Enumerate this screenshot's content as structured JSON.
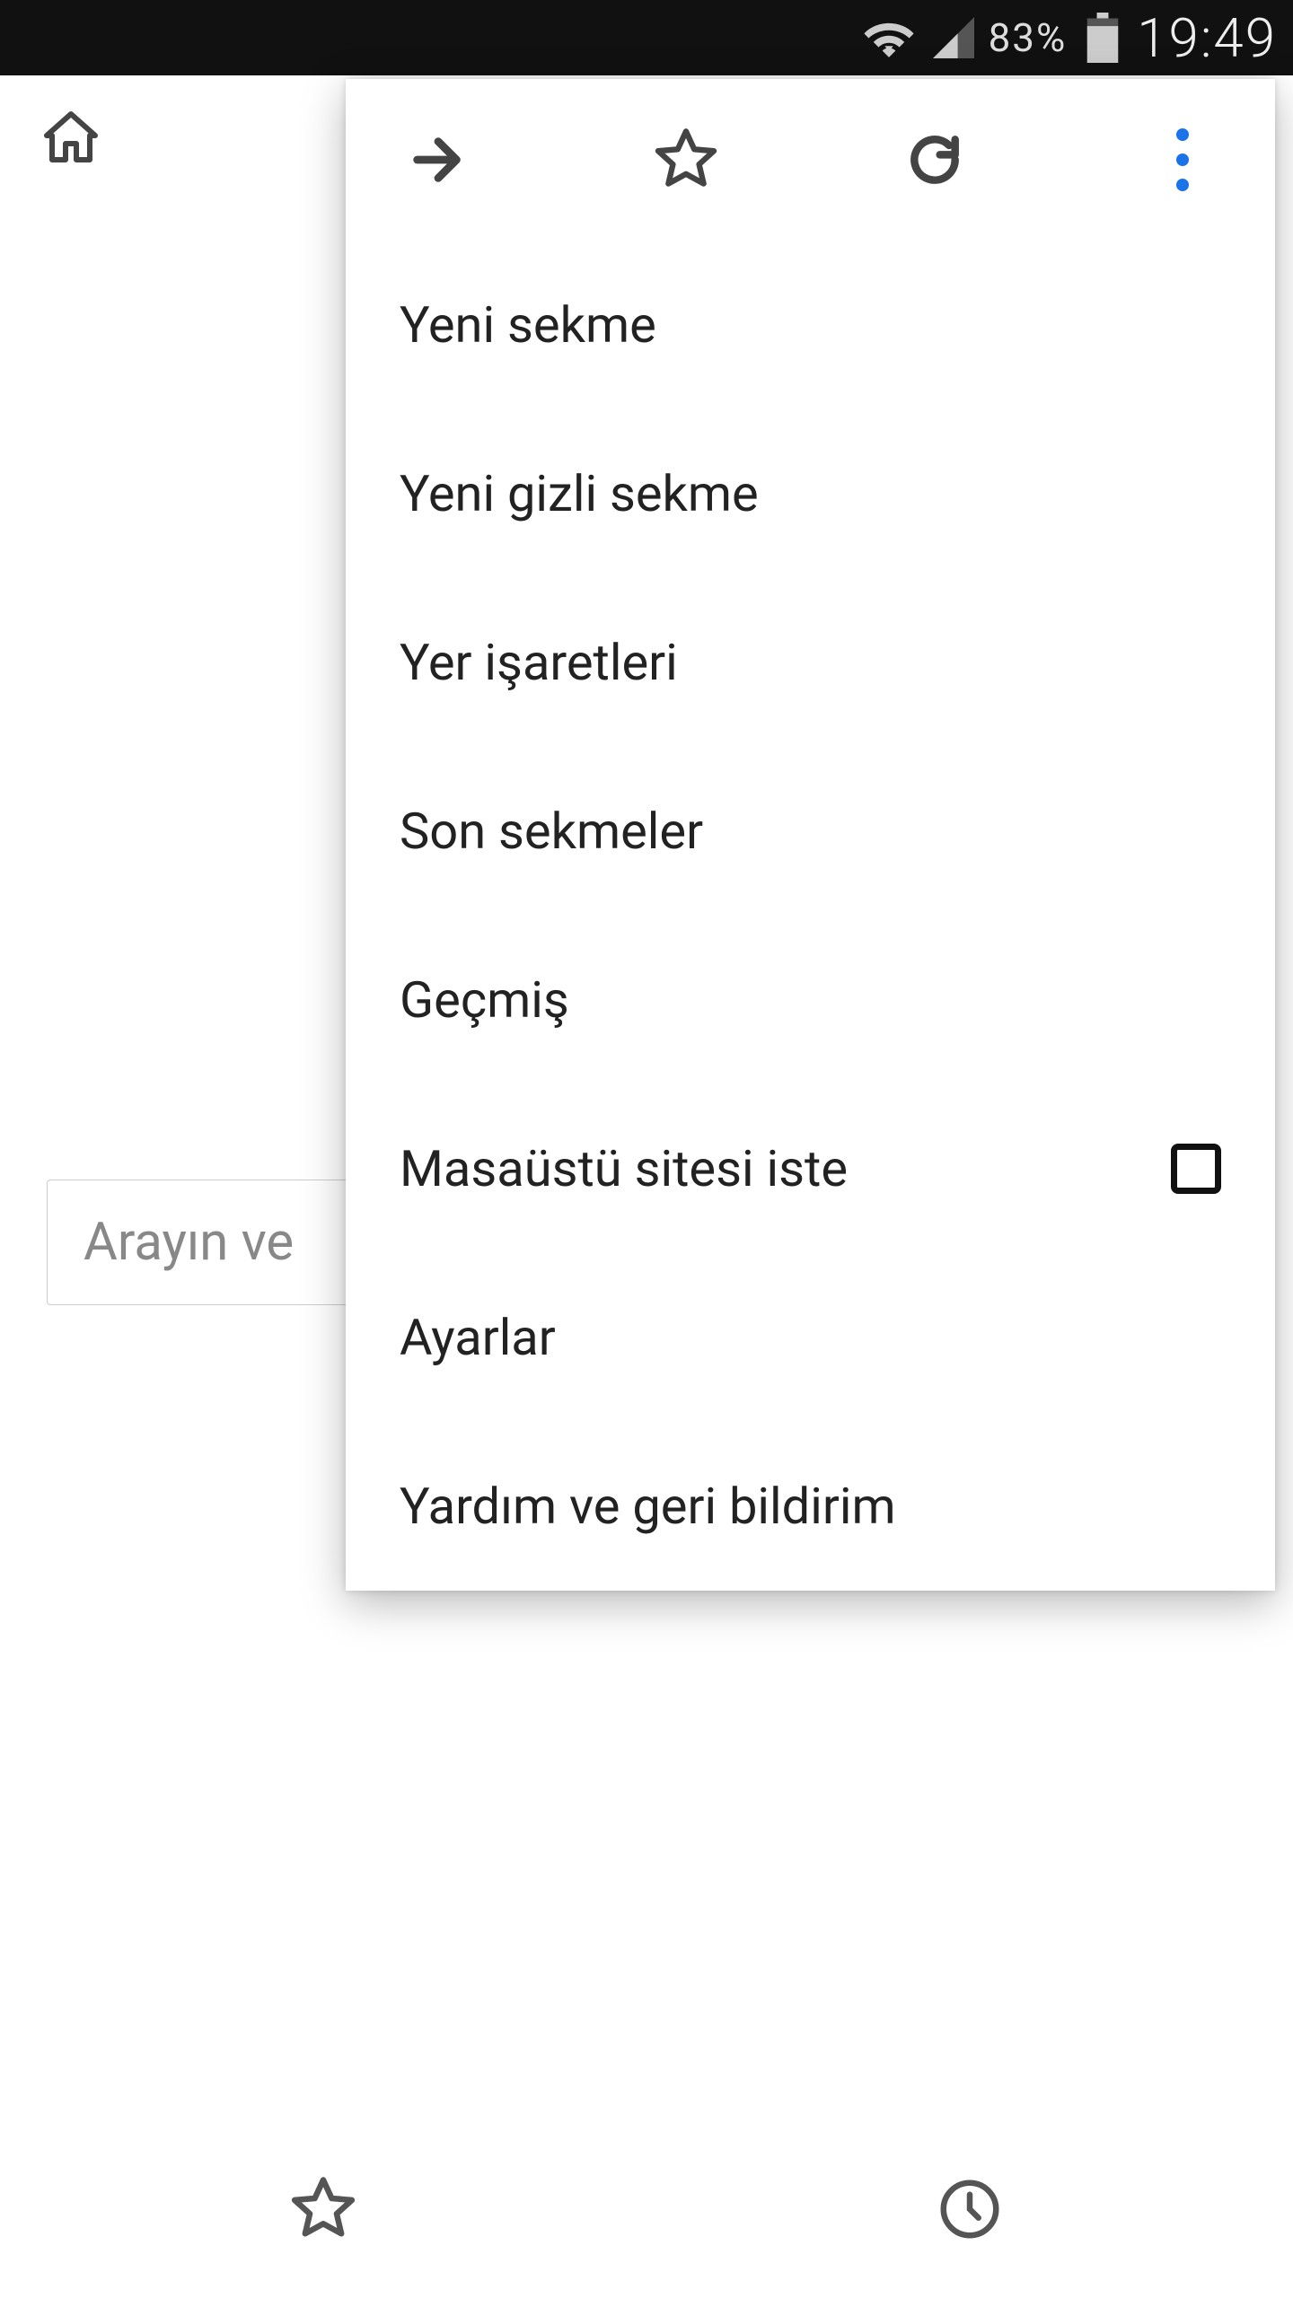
{
  "status": {
    "battery_pct": "83%",
    "clock": "19:49"
  },
  "search": {
    "placeholder": "Arayın ve"
  },
  "menu": {
    "items": [
      {
        "label": "Yeni sekme"
      },
      {
        "label": "Yeni gizli sekme"
      },
      {
        "label": "Yer işaretleri"
      },
      {
        "label": "Son sekmeler"
      },
      {
        "label": "Geçmiş"
      },
      {
        "label": "Masaüstü sitesi iste",
        "checkbox": true
      },
      {
        "label": "Ayarlar"
      },
      {
        "label": "Yardım ve geri bildirim"
      }
    ]
  }
}
